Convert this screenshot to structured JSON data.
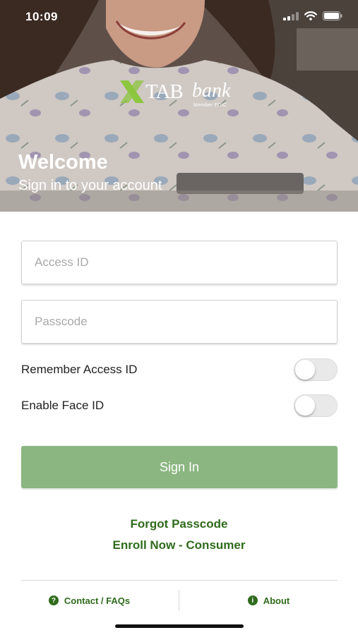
{
  "status_bar": {
    "time": "10:09"
  },
  "brand": {
    "tab": "TAB",
    "bank": "bank",
    "member": "Member FDIC"
  },
  "hero": {
    "title": "Welcome",
    "subtitle": "Sign in to your account"
  },
  "form": {
    "access_id": {
      "placeholder": "Access ID",
      "value": ""
    },
    "passcode": {
      "placeholder": "Passcode",
      "value": ""
    },
    "remember_label": "Remember Access ID",
    "remember_on": false,
    "face_id_label": "Enable Face ID",
    "face_id_on": false,
    "sign_in_label": "Sign In"
  },
  "links": {
    "forgot": "Forgot Passcode",
    "enroll": "Enroll Now - Consumer"
  },
  "bottom_bar": {
    "contact": "Contact / FAQs",
    "about": "About"
  },
  "colors": {
    "accent": "#2f6b1c",
    "button": "#8bb681",
    "logo_green": "#8dc63f"
  }
}
